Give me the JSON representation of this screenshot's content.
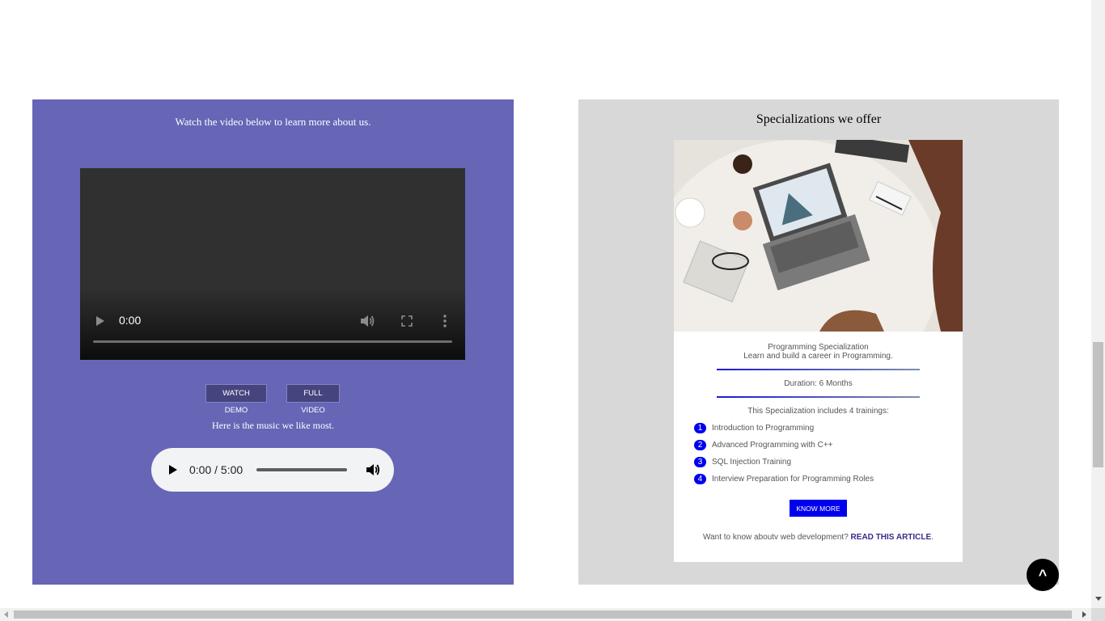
{
  "left_panel": {
    "intro": "Watch the video below to learn more about us.",
    "video": {
      "time": "0:00"
    },
    "buttons": {
      "watch_demo": "WATCH DEMO",
      "full_video": "FULL VIDEO"
    },
    "music_text": "Here is the music we like most.",
    "audio": {
      "time": "0:00 / 5:00"
    },
    "colors": {
      "background": "#6665b6",
      "button": "#45447f"
    }
  },
  "right_panel": {
    "title": "Specializations we offer",
    "card": {
      "image_icon": "workspace-photo",
      "line1": "Programming Specialization",
      "line2": "Learn and build a career in Programming.",
      "duration": "Duration: 6 Months",
      "includes": "This Specialization includes 4 trainings:",
      "trainings": [
        {
          "num": "1",
          "label": "Introduction to Programming"
        },
        {
          "num": "2",
          "label": "Advanced Programming with C++"
        },
        {
          "num": "3",
          "label": "SQL Injection Training"
        },
        {
          "num": "4",
          "label": "Interview Preparation for Programming Roles"
        }
      ],
      "know_more": "KNOW MORE",
      "article_prefix": "Want to know aboutv web development?",
      "article_link": "READ THIS ARTICLE",
      "article_suffix": "."
    },
    "colors": {
      "background": "#d8d8d8",
      "accent": "#0000ee"
    }
  },
  "back_to_top": {
    "label": "^"
  }
}
